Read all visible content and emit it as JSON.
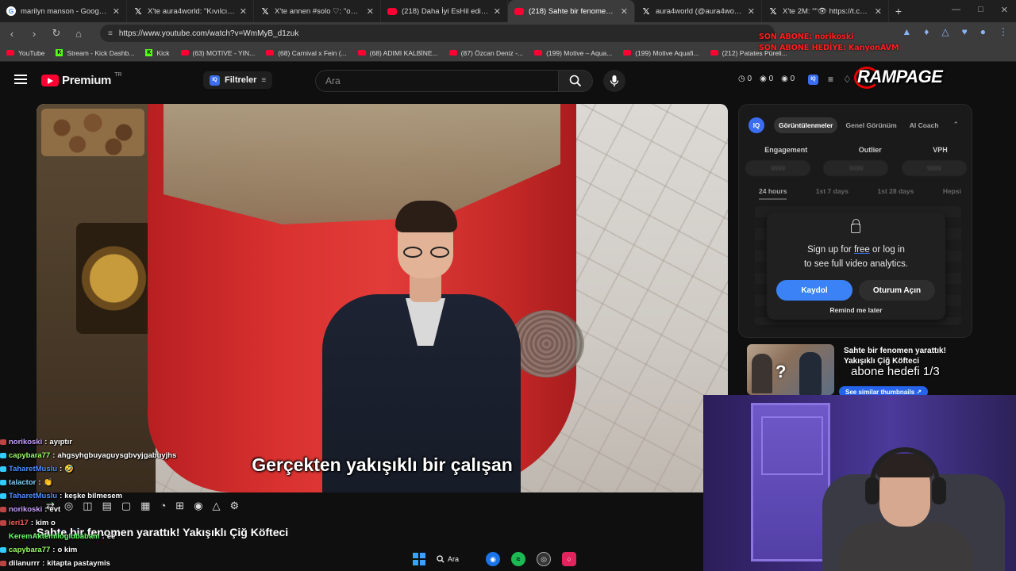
{
  "browser": {
    "tabs": [
      {
        "title": "marilyn manson - Google'da Ar",
        "icon": "google-icon"
      },
      {
        "title": "X'te aura4world: \"Kıvılcım bizde",
        "icon": "x-icon"
      },
      {
        "title": "X'te annen #solo ♡: \"on beş ma",
        "icon": "x-icon"
      },
      {
        "title": "(218) Daha İyi EsHil edition💅",
        "icon": "youtube-icon"
      },
      {
        "title": "(218) Sahte bir fenomen yarattı",
        "icon": "youtube-icon",
        "active": true
      },
      {
        "title": "aura4world (@aura4world) / X",
        "icon": "x-icon"
      },
      {
        "title": "X'te 2M: \"\"👁 https://t.co/KV",
        "icon": "x-icon"
      }
    ],
    "url": "https://www.youtube.com/watch?v=WmMyB_d1zuk",
    "bookmarks": [
      {
        "label": "YouTube",
        "kind": "yt"
      },
      {
        "label": "Stream - Kick Dashb...",
        "kind": "kick"
      },
      {
        "label": "Kick",
        "kind": "kick"
      },
      {
        "label": "(63) MOTIVE - YIN...",
        "kind": "yt"
      },
      {
        "label": "(68) Carnival x Fein (...",
        "kind": "yt"
      },
      {
        "label": "(68) ADIMI KALBİNE...",
        "kind": "yt"
      },
      {
        "label": "(87) Özcan Deniz -...",
        "kind": "yt"
      },
      {
        "label": "(199) Motive – Aqua...",
        "kind": "yt"
      },
      {
        "label": "(199) Motive Aquafi...",
        "kind": "yt"
      },
      {
        "label": "(212) Patates Püreli...",
        "kind": "yt"
      }
    ]
  },
  "youtube": {
    "logo_text": "Premium",
    "logo_sup": "TR",
    "filter_label": "Filtreler",
    "search_placeholder": "Ara",
    "mini_stats": [
      "0",
      "0",
      "0"
    ]
  },
  "overlay": {
    "son_abone": "SON ABONE: norikoski",
    "son_abone_hediye": "SON ABONE HEDİYE: KanyonAVM",
    "rampage": "RAMPAGE",
    "abone_hedefi": "abone hedefi 1/3"
  },
  "video": {
    "subtitle": "Gerçekten yakışıklı bir çalışan",
    "title": "Sahte bir fenomen yarattık! Yakışıklı Çiğ Köfteci"
  },
  "vidiq": {
    "logo": "IQ",
    "tabs": [
      "Görüntülenmeler",
      "Genel Görünüm",
      "AI Coach"
    ],
    "metrics": [
      "Engagement",
      "Outlier",
      "VPH"
    ],
    "metric_placeholder": "9999",
    "ranges": [
      "24 hours",
      "1st 7 days",
      "1st 28 days",
      "Hepsi"
    ],
    "login_line1_pre": "Sign up for ",
    "login_line1_free": "free",
    "login_line1_post": " or log in",
    "login_line2": "to see full video analytics.",
    "signup": "Kaydol",
    "login": "Oturum Açın",
    "remind": "Remind me later"
  },
  "recommendation": {
    "title": "Sahte bir fenomen yarattık! Yakışıklı Çiğ Köfteci",
    "similar": "See similar thumbnails ↗"
  },
  "chat": [
    {
      "user": "norikoski",
      "color": "#c9a0ff",
      "msg": "ayıptır",
      "badge": "#b44"
    },
    {
      "user": "capybara77",
      "color": "#9cff6b",
      "msg": "ahgsyhgbuyaguysgbvyjgabuyjhs",
      "badge": "#3cf"
    },
    {
      "user": "TaharetMuslu",
      "color": "#4a90ff",
      "msg": "🤣",
      "badge": "#3cf"
    },
    {
      "user": "talactor",
      "color": "#7fd0ff",
      "msg": "👏",
      "badge": "#3cf"
    },
    {
      "user": "TaharetMuslu",
      "color": "#4a90ff",
      "msg": "keşke bilmesem",
      "badge": "#3cf"
    },
    {
      "user": "norikoski",
      "color": "#c9a0ff",
      "msg": "evt",
      "badge": "#b44"
    },
    {
      "user": "ieri17",
      "color": "#ff5a5a",
      "msg": "kim o",
      "badge": "#b44"
    },
    {
      "user": "KeremAktemlioglubabam",
      "color": "#6bff6b",
      "msg": "ee",
      "badge": ""
    },
    {
      "user": "capybara77",
      "color": "#9cff6b",
      "msg": "o kim",
      "badge": "#3cf"
    },
    {
      "user": "dilanurrr",
      "color": "#ffffff",
      "msg": "kitapta pastaymis",
      "badge": "#b44"
    }
  ],
  "taskbar": {
    "search_label": "Ara"
  }
}
